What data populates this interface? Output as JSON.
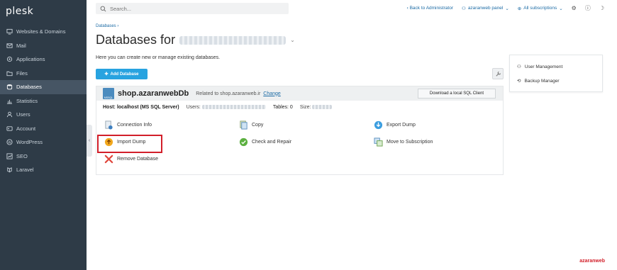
{
  "app": {
    "logo": "plesk"
  },
  "sidebar": {
    "items": [
      {
        "label": "Websites & Domains",
        "icon": "monitor-icon",
        "active": false
      },
      {
        "label": "Mail",
        "icon": "mail-icon",
        "active": false
      },
      {
        "label": "Applications",
        "icon": "apps-icon",
        "active": false
      },
      {
        "label": "Files",
        "icon": "folder-icon",
        "active": false
      },
      {
        "label": "Databases",
        "icon": "database-icon",
        "active": true
      },
      {
        "label": "Statistics",
        "icon": "chart-icon",
        "active": false
      },
      {
        "label": "Users",
        "icon": "user-icon",
        "active": false
      },
      {
        "label": "Account",
        "icon": "account-icon",
        "active": false
      },
      {
        "label": "WordPress",
        "icon": "wordpress-icon",
        "active": false
      },
      {
        "label": "SEO",
        "icon": "seo-icon",
        "active": false
      },
      {
        "label": "Laravel",
        "icon": "laravel-icon",
        "active": false
      }
    ]
  },
  "topbar": {
    "search_placeholder": "Search...",
    "back_link": "‹ Back to Administrator",
    "user": "azaranweb panel",
    "subscriptions": "All subscriptions"
  },
  "main": {
    "breadcrumb": "Databases",
    "title": "Databases for",
    "subtitle": "Here you can create new or manage existing databases.",
    "add_button": "Add Database"
  },
  "right_panel": {
    "items": [
      {
        "label": "User Management"
      },
      {
        "label": "Backup Manager"
      }
    ]
  },
  "db_card": {
    "name": "shop.azaranwebDb",
    "logo_text": "MSSQL",
    "related_text": "Related to shop.azaranweb.ir",
    "change_link": "Change",
    "download_button": "Download a local SQL Client",
    "host_label": "Host: localhost (MS SQL Server)",
    "users_label": "Users:",
    "tables_label": "Tables: 0",
    "size_label": "Size:",
    "actions": [
      {
        "label": "Connection Info",
        "icon": "connection-info-icon"
      },
      {
        "label": "Copy",
        "icon": "copy-icon"
      },
      {
        "label": "Export Dump",
        "icon": "export-dump-icon"
      },
      {
        "label": "Import Dump",
        "icon": "import-dump-icon"
      },
      {
        "label": "Check and Repair",
        "icon": "check-repair-icon"
      },
      {
        "label": "Move to Subscription",
        "icon": "move-subscription-icon"
      },
      {
        "label": "Remove Database",
        "icon": "remove-database-icon"
      }
    ]
  },
  "watermark": "azaranweb",
  "colors": {
    "sidebar": "#2e3b47",
    "accent": "#28a3e0",
    "link": "#1c6ba5",
    "highlight": "#d21f2a"
  }
}
